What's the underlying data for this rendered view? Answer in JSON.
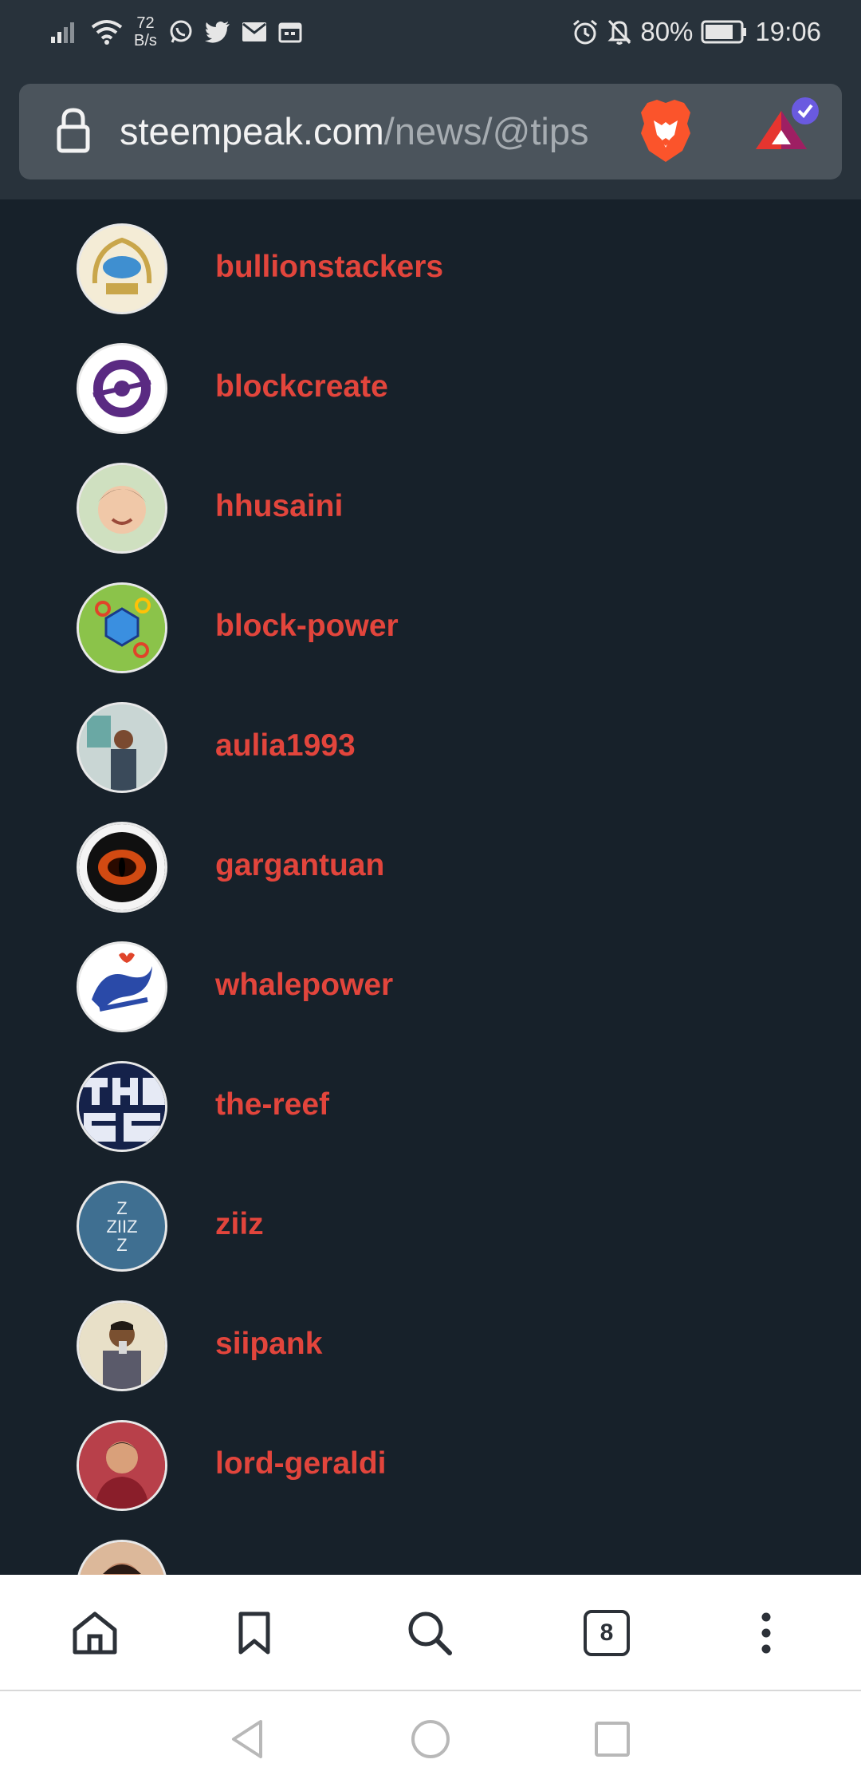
{
  "status_bar": {
    "net_speed_value": "72",
    "net_speed_unit": "B/s",
    "battery_percent": "80%",
    "time": "19:06",
    "icons": [
      "signal-icon",
      "wifi-icon",
      "whatsapp-icon",
      "twitter-icon",
      "mail-icon",
      "calendar-icon",
      "alarm-icon",
      "bell-off-icon",
      "battery-icon"
    ]
  },
  "url_bar": {
    "domain": "steempeak.com",
    "path": "/news/@tips",
    "icons": [
      "lock-icon",
      "brave-shields-icon",
      "brave-rewards-icon"
    ]
  },
  "users": [
    {
      "name": "bullionstackers",
      "color": "#c9a64a"
    },
    {
      "name": "blockcreate",
      "color": "#5a2a82"
    },
    {
      "name": "hhusaini",
      "color": "#d8b9a0"
    },
    {
      "name": "block-power",
      "color": "#8bc34a"
    },
    {
      "name": "aulia1993",
      "color": "#6b8a99"
    },
    {
      "name": "gargantuan",
      "color": "#d24a12"
    },
    {
      "name": "whalepower",
      "color": "#2a4aa8"
    },
    {
      "name": "the-reef",
      "color": "#1a2a55"
    },
    {
      "name": "ziiz",
      "avatar_text": "Z\nZIIZ\nZ",
      "color": "#3f6f91"
    },
    {
      "name": "siipank",
      "color": "#a08060"
    },
    {
      "name": "lord-geraldi",
      "color": "#a3303a"
    }
  ],
  "bottom_bar": {
    "tab_count": "8",
    "icons": [
      "home-icon",
      "bookmark-icon",
      "search-icon",
      "tabs-icon",
      "more-vert-icon"
    ]
  },
  "nav_bar": {
    "icons": [
      "back-icon",
      "home-circle-icon",
      "recents-icon"
    ]
  }
}
